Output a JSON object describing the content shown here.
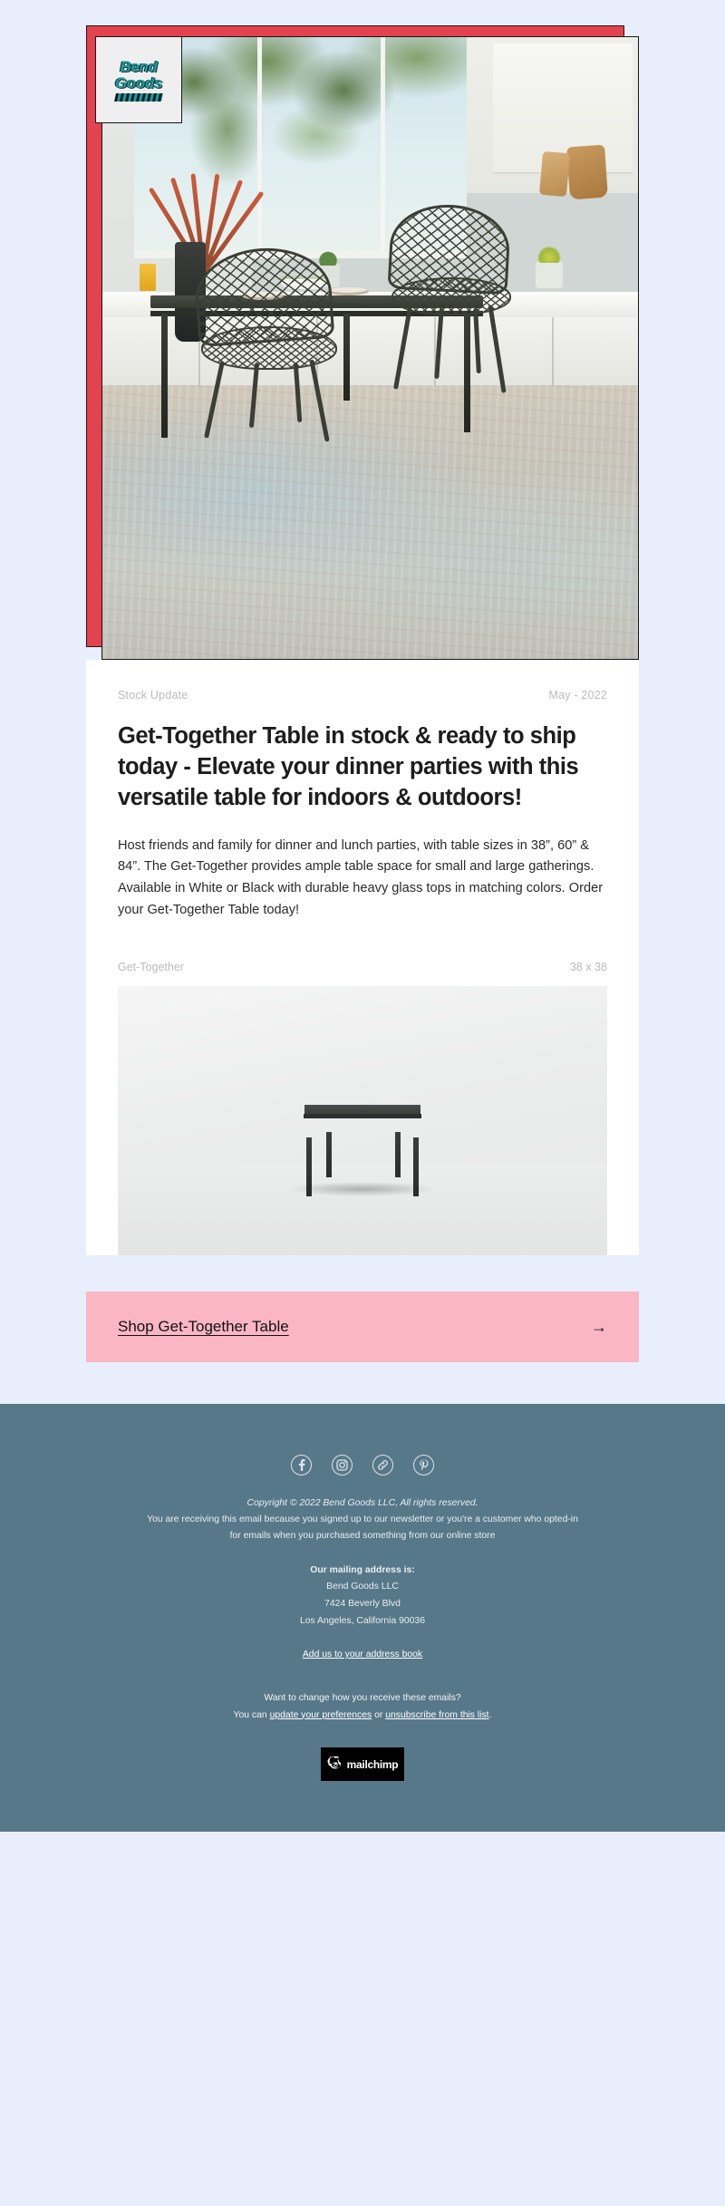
{
  "brand": {
    "logo_line1": "Bend",
    "logo_line2": "Goods",
    "logo_alt": "bend-goods-logo"
  },
  "article": {
    "kicker": "Stock Update",
    "date": "May - 2022",
    "headline": "Get-Together Table in stock & ready to ship today - Elevate your dinner parties with this versatile table for indoors & outdoors!",
    "body": "Host friends and family for dinner and lunch parties, with table sizes in 38”, 60” & 84”. The Get-Together provides ample table space for small and large gatherings. Available in White or Black with durable heavy glass tops in matching colors. Order your Get-Together Table today!"
  },
  "product": {
    "name": "Get-Together",
    "size": "38 x 38"
  },
  "cta": {
    "label": "Shop Get-Together Table",
    "arrow": "→",
    "background": "#FBB6C4"
  },
  "footer": {
    "background": "#577889",
    "socials": [
      {
        "name": "facebook",
        "icon": "facebook-icon"
      },
      {
        "name": "instagram",
        "icon": "instagram-icon"
      },
      {
        "name": "website-link",
        "icon": "link-icon"
      },
      {
        "name": "pinterest",
        "icon": "pinterest-icon"
      }
    ],
    "copyright": "Copyright © 2022 Bend Goods LLC, All rights reserved.",
    "reason_line1": "You are receiving this email because you signed up to our newsletter or you're a customer who opted-in",
    "reason_line2": "for emails when you purchased something from our online store",
    "address_heading": "Our mailing address is:",
    "address_line1": "Bend Goods LLC",
    "address_line2": "7424 Beverly Blvd",
    "address_line3": "Los Angeles, California 90036",
    "address_book_link": "Add us to your address book",
    "prefs_question": "Want to change how you receive these emails?",
    "prefs_prefix": "You can ",
    "prefs_link": "update your preferences",
    "prefs_middle": " or ",
    "unsub_link": "unsubscribe from this list",
    "prefs_suffix": ".",
    "mailchimp_label": "mailchimp"
  }
}
